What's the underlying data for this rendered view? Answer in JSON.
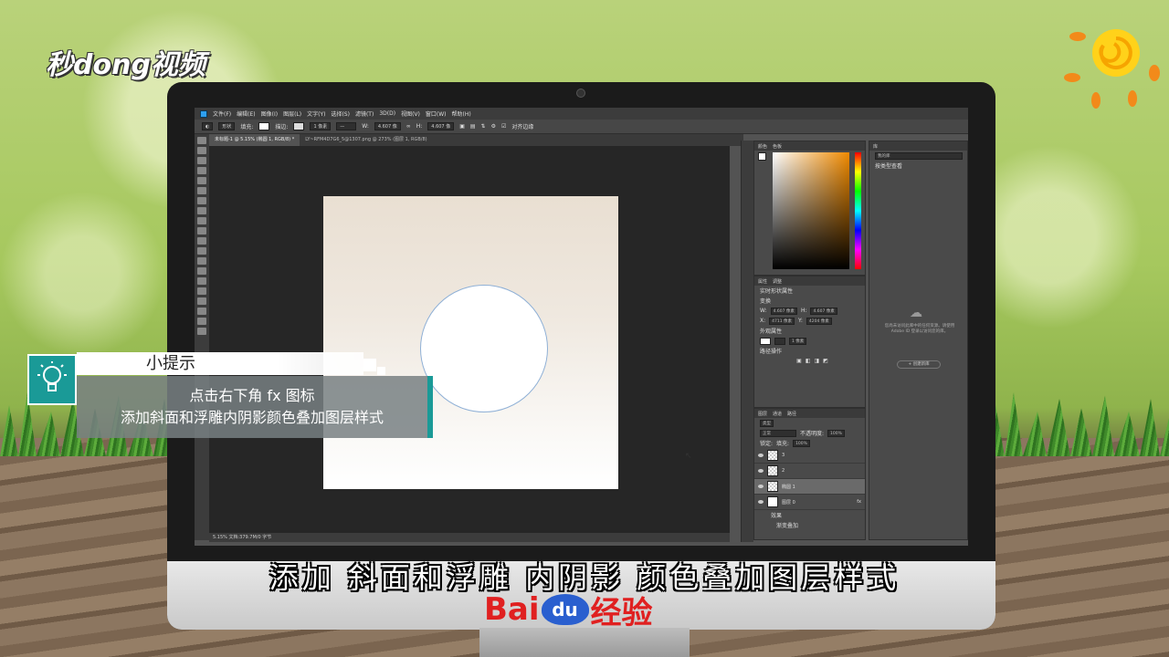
{
  "watermark": {
    "logo_text": "秒dong视频"
  },
  "ps": {
    "menus": [
      "文件(F)",
      "编辑(E)",
      "图像(I)",
      "图层(L)",
      "文字(Y)",
      "选择(S)",
      "滤镜(T)",
      "3D(D)",
      "视图(V)",
      "窗口(W)",
      "帮助(H)"
    ],
    "options": {
      "shape_mode": "形状",
      "fill_label": "填充:",
      "stroke_label": "描边:",
      "stroke_size": "1 像素",
      "width_label": "W:",
      "width_value": "4.607 像",
      "height_label": "H:",
      "height_value": "4.607 像",
      "align_label": "对齐边缘"
    },
    "tabs": [
      {
        "label": "未标题-1 @ 5.15% (椭圆 1, RGB/8) *",
        "active": true
      },
      {
        "label": "LY~RFM4D7G6_5@1307.png @ 273% (图层 1, RGB/8)",
        "active": false
      }
    ],
    "status": "5.15%      文档:379.7M/0 字节",
    "color_panel": {
      "tabs": [
        "颜色",
        "色板"
      ]
    },
    "properties_panel": {
      "tabs": [
        "属性",
        "调整"
      ],
      "title": "实时形状属性",
      "w_value": "4.607 像素",
      "h_value": "4.607 像素",
      "x_value": "4711 像素",
      "y_value": "4204 像素",
      "appearance_label": "外观属性",
      "stroke_value": "1 像素",
      "path_ops_label": "路径操作",
      "section_transform": "变换"
    },
    "layers_panel": {
      "tabs": [
        "图层",
        "通道",
        "路径"
      ],
      "filter_label": "类型",
      "blend_mode": "正常",
      "opacity_label": "不透明度:",
      "opacity_value": "100%",
      "lock_label": "锁定:",
      "fill_label": "填充:",
      "fill_value": "100%",
      "layers": [
        {
          "name": "3",
          "type": "checker",
          "selected": false
        },
        {
          "name": "2",
          "type": "checker",
          "selected": false
        },
        {
          "name": "椭圆 1",
          "type": "checker",
          "selected": true
        },
        {
          "name": "图层 0",
          "type": "white",
          "selected": false
        }
      ],
      "effects_label": "效果",
      "effect_item": "渐变叠加"
    },
    "libraries_panel": {
      "tab": "库",
      "dropdown": "我的库",
      "view_label": "按类型查看",
      "message": "您尚未访问此库中的任何资源。请使用 Adobe ID 登录以访问您的库。",
      "button": "+ 创建新库"
    }
  },
  "tip": {
    "title": "小提示",
    "line1": "点击右下角 fx 图标",
    "line2": "添加斜面和浮雕内阴影颜色叠加图层样式"
  },
  "subtitle": "添加  斜面和浮雕  内阴影  颜色叠加图层样式",
  "baidu": {
    "part1": "Bai",
    "paw": "du",
    "part2": "经验"
  },
  "colors": {
    "teal": "#1a9a97",
    "baidu_red": "#e02020",
    "baidu_blue": "#2a5fcf",
    "ps_bg": "#535353"
  }
}
